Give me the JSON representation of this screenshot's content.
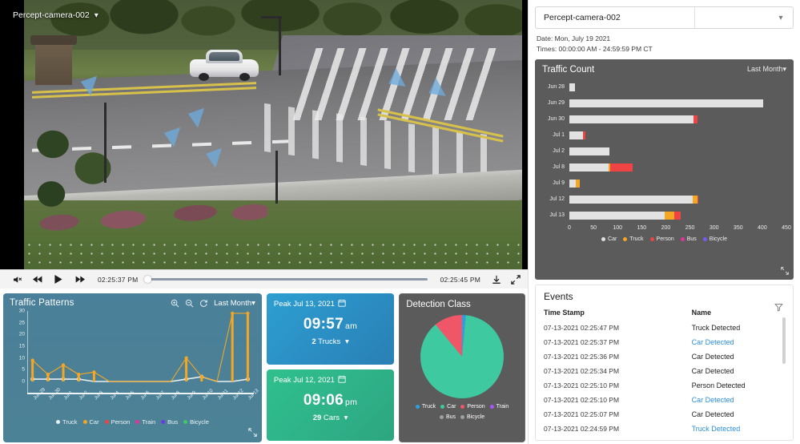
{
  "video": {
    "camera_label": "Percept-camera-002",
    "chevron_icon": "chevron-down-icon",
    "controls": {
      "mute_icon": "mute-icon",
      "rewind_icon": "rewind-icon",
      "play_icon": "play-icon",
      "forward_icon": "fast-forward-icon",
      "current_time": "02:25:37 PM",
      "end_time": "02:25:45 PM",
      "download_icon": "download-icon",
      "fullscreen_icon": "fullscreen-icon"
    }
  },
  "camera_picker": {
    "value": "Percept-camera-002",
    "chevron_icon": "chevron-down-icon"
  },
  "meta": {
    "date_line": "Date: Mon, July 19 2021",
    "times_line": "Times: 00:00:00 AM - 24:59:59 PM CT"
  },
  "traffic_count": {
    "title": "Traffic Count",
    "range_label": "Last Month",
    "range_caret": "▾",
    "expand_icon": "expand-icon"
  },
  "traffic_patterns": {
    "title": "Traffic Patterns",
    "zoom_in_icon": "zoom-in-icon",
    "zoom_out_icon": "zoom-out-icon",
    "reset_icon": "reset-icon",
    "range_label": "Last Month",
    "range_caret": "▾",
    "expand_icon": "expand-icon"
  },
  "peaks": [
    {
      "name": "peak-card-truck",
      "heading": "Peak Jul 13, 2021",
      "calendar_icon": "calendar-icon",
      "time": "09:57",
      "ampm": "am",
      "count": "2",
      "class_label": "Trucks",
      "caret": "▾",
      "color": "#2b8fc4"
    },
    {
      "name": "peak-card-car",
      "heading": "Peak Jul 12, 2021",
      "calendar_icon": "calendar-icon",
      "time": "09:06",
      "ampm": "pm",
      "count": "29",
      "class_label": "Cars",
      "caret": "▾",
      "color": "#2fb389"
    }
  ],
  "detection_class": {
    "title": "Detection Class"
  },
  "events": {
    "title": "Events",
    "filter_icon": "filter-icon",
    "columns": [
      "Time Stamp",
      "Name"
    ],
    "rows": [
      {
        "timestamp": "07-13-2021 02:25:47 PM",
        "name": "Truck Detected",
        "highlighted": false
      },
      {
        "timestamp": "07-13-2021 02:25:37 PM",
        "name": "Car Detected",
        "highlighted": true
      },
      {
        "timestamp": "07-13-2021 02:25:36 PM",
        "name": "Car Detected",
        "highlighted": false
      },
      {
        "timestamp": "07-13-2021 02:25:34 PM",
        "name": "Car Detected",
        "highlighted": false
      },
      {
        "timestamp": "07-13-2021 02:25:10 PM",
        "name": "Person Detected",
        "highlighted": false
      },
      {
        "timestamp": "07-13-2021 02:25:10 PM",
        "name": "Car Detected",
        "highlighted": true
      },
      {
        "timestamp": "07-13-2021 02:25:07 PM",
        "name": "Car Detected",
        "highlighted": false
      },
      {
        "timestamp": "07-13-2021 02:24:59 PM",
        "name": "Truck Detected",
        "highlighted": true
      }
    ]
  },
  "colors": {
    "car": "#e2e2e2",
    "truck": "#f5a623",
    "person": "#ef4444",
    "bus": "#e0339c",
    "bicycle": "#7a5af0",
    "train": "#a855f7",
    "pie_truck": "#2b9fe0",
    "pie_car": "#3ec9a0",
    "pie_person": "#ef5668",
    "pie_train": "#a855f7",
    "pie_bus": "#9aa0a6",
    "pie_bicycle": "#9aa0a6",
    "panel_dark": "#5b5b5b",
    "accent_blue": "#2b8fd8"
  },
  "chart_data": [
    {
      "type": "bar",
      "orientation": "horizontal",
      "title": "Traffic Count",
      "xlabel": "",
      "ylabel": "",
      "xlim": [
        0,
        450
      ],
      "xticks": [
        0,
        50,
        100,
        150,
        200,
        250,
        300,
        350,
        400,
        450
      ],
      "grid": false,
      "stacked": true,
      "legend_position": "bottom",
      "categories": [
        "Jun 28",
        "Jun 29",
        "Jun 30",
        "Jul 1",
        "Jul 2",
        "Jul 8",
        "Jul 9",
        "Jul 12",
        "Jul 13"
      ],
      "series": [
        {
          "name": "Car",
          "color": "#e2e2e2",
          "values": [
            12,
            402,
            258,
            28,
            83,
            81,
            13,
            256,
            197
          ]
        },
        {
          "name": "Truck",
          "color": "#f5a623",
          "values": [
            0,
            0,
            0,
            0,
            0,
            4,
            9,
            9,
            20
          ]
        },
        {
          "name": "Person",
          "color": "#ef4444",
          "values": [
            0,
            0,
            7,
            6,
            0,
            46,
            0,
            3,
            14
          ]
        },
        {
          "name": "Bus",
          "color": "#e0339c",
          "values": [
            0,
            0,
            0,
            0,
            0,
            0,
            0,
            0,
            0
          ]
        },
        {
          "name": "Bicycle",
          "color": "#7a5af0",
          "values": [
            0,
            0,
            0,
            0,
            0,
            0,
            0,
            0,
            0
          ]
        }
      ]
    },
    {
      "type": "line",
      "title": "Traffic Patterns",
      "xlabel": "",
      "ylabel": "",
      "ylim": [
        0,
        30
      ],
      "yticks": [
        0,
        5,
        10,
        15,
        20,
        25,
        30
      ],
      "grid": false,
      "legend_position": "bottom",
      "x": [
        "Jun 29",
        "Jun 30",
        "Jul 1",
        "Jul 2",
        "Jul 3",
        "Jul 4",
        "Jul 5",
        "Jul 6",
        "Jul 7",
        "Jul 8",
        "Jul 9",
        "Jul 10",
        "Jul 11",
        "Jul 12",
        "Jul 13"
      ],
      "series": [
        {
          "name": "Truck",
          "color": "#e8eef0",
          "values": [
            1,
            1,
            1,
            1,
            0,
            0,
            0,
            0,
            0,
            0,
            1,
            2,
            0,
            0,
            1
          ]
        },
        {
          "name": "Car",
          "color": "#f5a623",
          "values": [
            9,
            3,
            7,
            3,
            4,
            0,
            0,
            0,
            0,
            0,
            10,
            2,
            0,
            29,
            29
          ]
        },
        {
          "name": "Person",
          "color": "#ef4444",
          "values": [
            0,
            0,
            0,
            0,
            0,
            0,
            0,
            0,
            0,
            0,
            0,
            0,
            0,
            0,
            0
          ]
        },
        {
          "name": "Train",
          "color": "#e0339c",
          "values": [
            0,
            0,
            0,
            0,
            0,
            0,
            0,
            0,
            0,
            0,
            0,
            0,
            0,
            0,
            0
          ]
        },
        {
          "name": "Bus",
          "color": "#6a3ae0",
          "values": [
            0,
            0,
            0,
            0,
            0,
            0,
            0,
            0,
            0,
            0,
            0,
            0,
            0,
            0,
            0
          ]
        },
        {
          "name": "Bicycle",
          "color": "#3ec96a",
          "values": [
            0,
            0,
            0,
            0,
            0,
            0,
            0,
            0,
            0,
            0,
            0,
            0,
            0,
            0,
            0
          ]
        }
      ]
    },
    {
      "type": "pie",
      "title": "Detection Class",
      "legend_position": "bottom",
      "labels": [
        "Truck",
        "Car",
        "Person",
        "Train",
        "Bus",
        "Bicycle"
      ],
      "colors": [
        "#2b9fe0",
        "#3ec9a0",
        "#ef5668",
        "#a855f7",
        "#9aa0a6",
        "#9aa0a6"
      ],
      "values": [
        1.5,
        87.5,
        11,
        0,
        0,
        0
      ]
    }
  ]
}
